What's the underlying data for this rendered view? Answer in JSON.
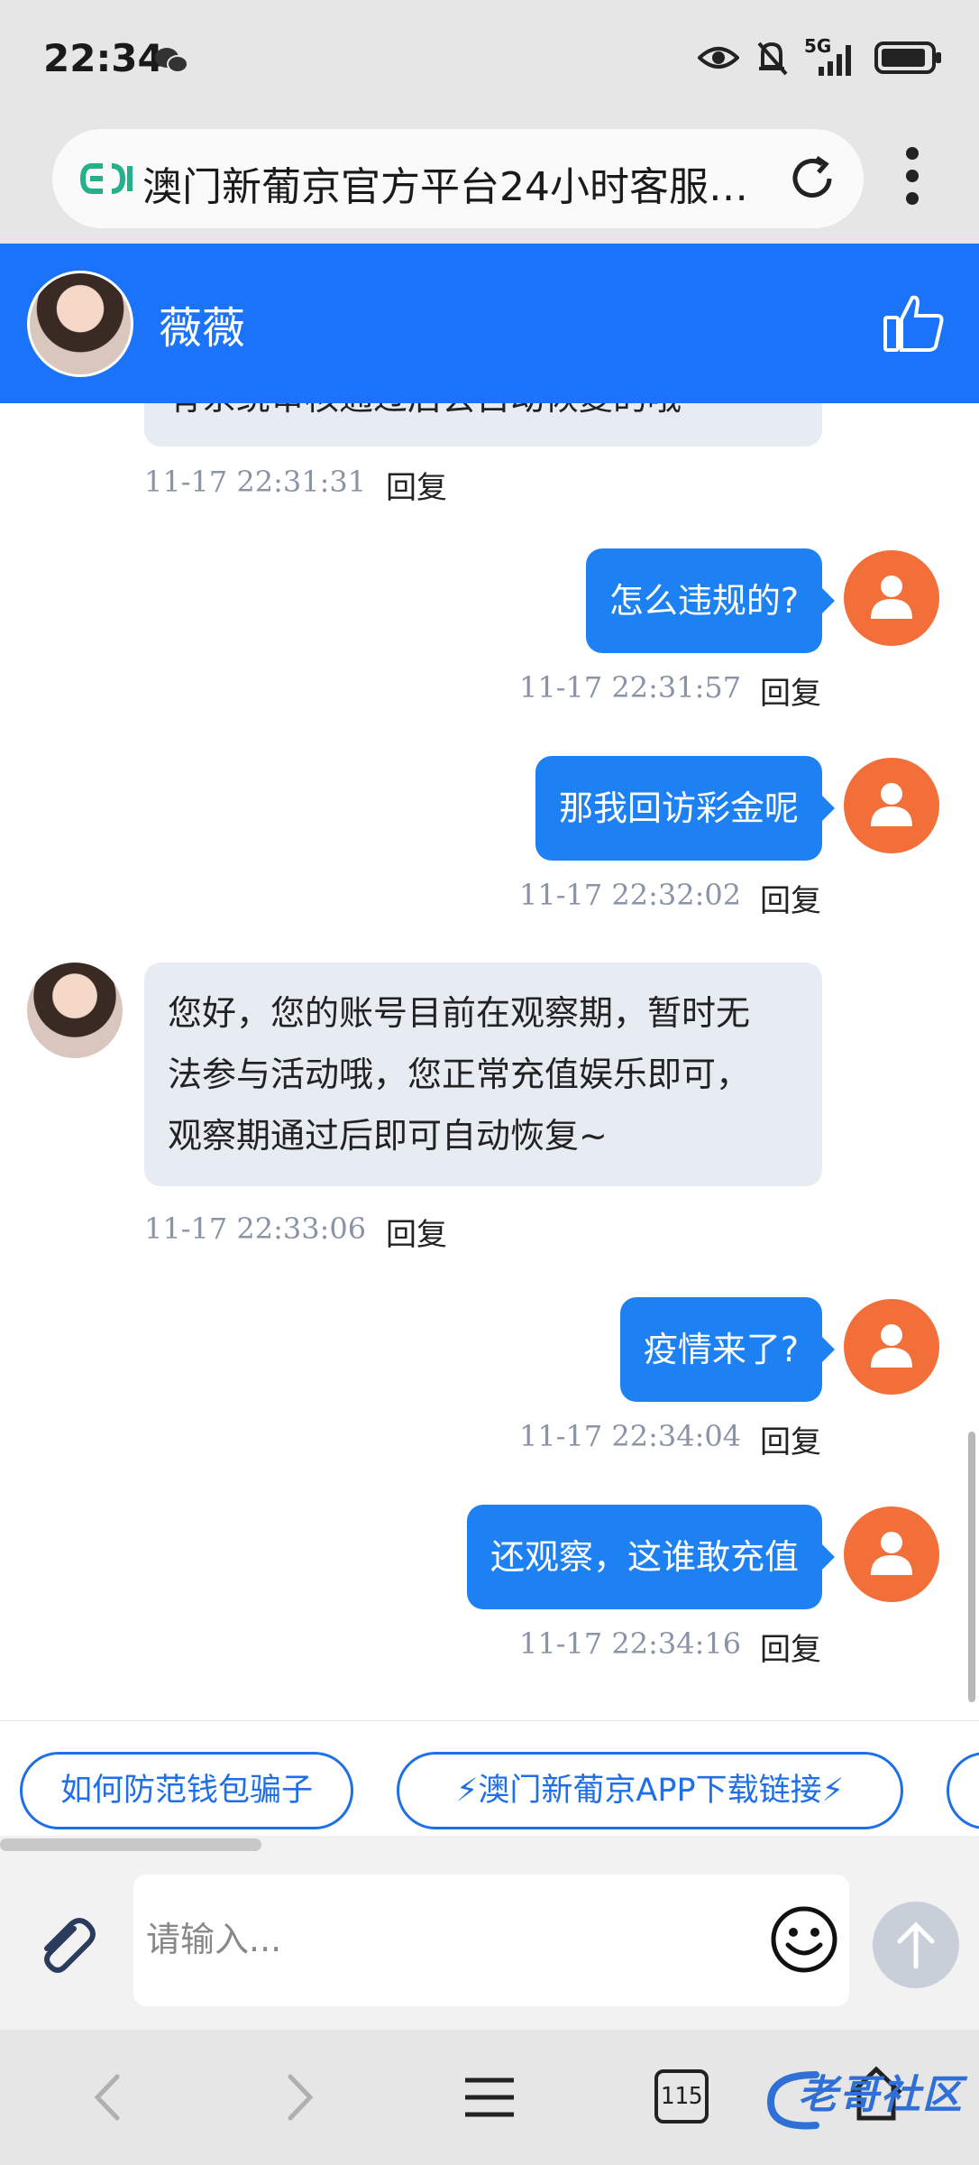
{
  "status_bar": {
    "time": "22:34",
    "network": "5G",
    "icons": [
      "wechat-icon",
      "eye-icon",
      "bell-muted-icon",
      "signal-icon",
      "battery-icon"
    ]
  },
  "browser": {
    "url_title": "澳门新葡京官方平台24小时客服中...",
    "tabs_count": "115"
  },
  "chat": {
    "agent_name": "薇薇",
    "reply_label": "回复",
    "messages": [
      {
        "side": "agent",
        "text": "有系统审核通过后会自动恢复的哦",
        "time": "11-17 22:31:31"
      },
      {
        "side": "user",
        "text": "怎么违规的?",
        "time": "11-17 22:31:57"
      },
      {
        "side": "user",
        "text": "那我回访彩金呢",
        "time": "11-17 22:32:02"
      },
      {
        "side": "agent",
        "text_lines": [
          "您好，您的账号目前在观察期，暂时无",
          "法参与活动哦，您正常充值娱乐即可，",
          "观察期通过后即可自动恢复~"
        ],
        "time": "11-17 22:33:06"
      },
      {
        "side": "user",
        "text": "疫情来了?",
        "time": "11-17 22:34:04"
      },
      {
        "side": "user",
        "text": "还观察，这谁敢充值",
        "time": "11-17 22:34:16"
      }
    ]
  },
  "quick_replies": [
    "如何防范钱包骗子",
    "⚡澳门新葡京APP下载链接⚡"
  ],
  "input": {
    "placeholder": "请输入..."
  },
  "watermark": "老哥社区",
  "colors": {
    "header_blue": "#1a73f8",
    "user_bubble": "#1e81f3",
    "agent_bubble": "#e7ebf2",
    "user_avatar": "#f36f3a",
    "chip_border": "#1e6fe8"
  }
}
